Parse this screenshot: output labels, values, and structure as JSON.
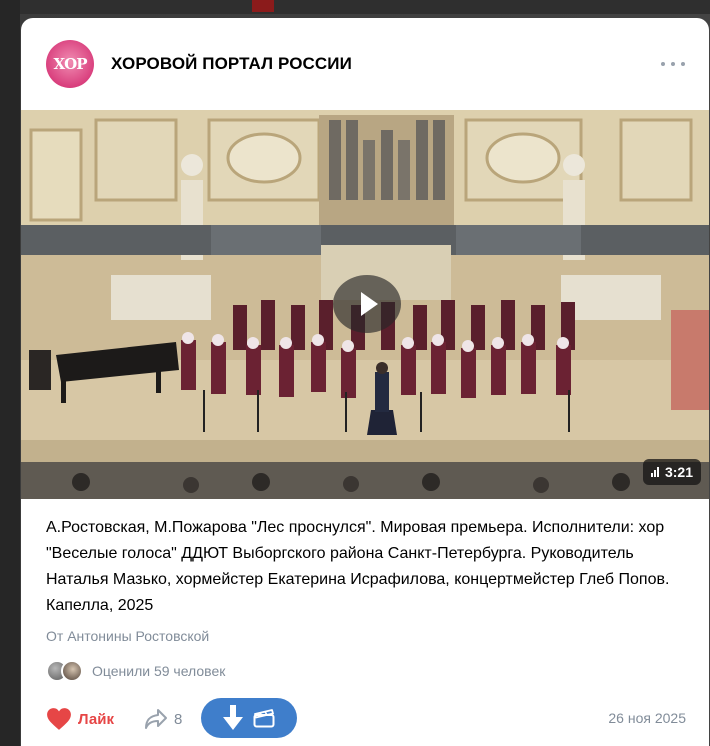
{
  "community": {
    "name": "ХОРОВОЙ ПОРТАЛ РОССИИ",
    "logo_text": "ХОР"
  },
  "video": {
    "duration": "3:21",
    "title": "А.Ростовская, М.Пожарова \"Лес проснулся\". Мировая премьера. Исполнители: хор \"Веселые голоса\" ДДЮТ Выборгского района Санкт-Петербурга. Руководитель Наталья Мазько, хормейстер Екатерина Исрафилова, концертмейстер Глеб Попов. Капелла, 2025"
  },
  "post": {
    "author": "От Антонины Ростовской",
    "rated_by": "Оценили 59 человек",
    "like_label": "Лайк",
    "share_count": "8",
    "date": "26 ноя 2025"
  },
  "colors": {
    "like": "#e64646",
    "accent": "#3f7ecb",
    "secondary_text": "#818c99",
    "brand_pink": "#d93f7d"
  },
  "icons": [
    "more-icon",
    "play-icon",
    "audio-bars-icon",
    "heart-icon",
    "share-icon",
    "download-icon",
    "clapperboard-icon"
  ]
}
